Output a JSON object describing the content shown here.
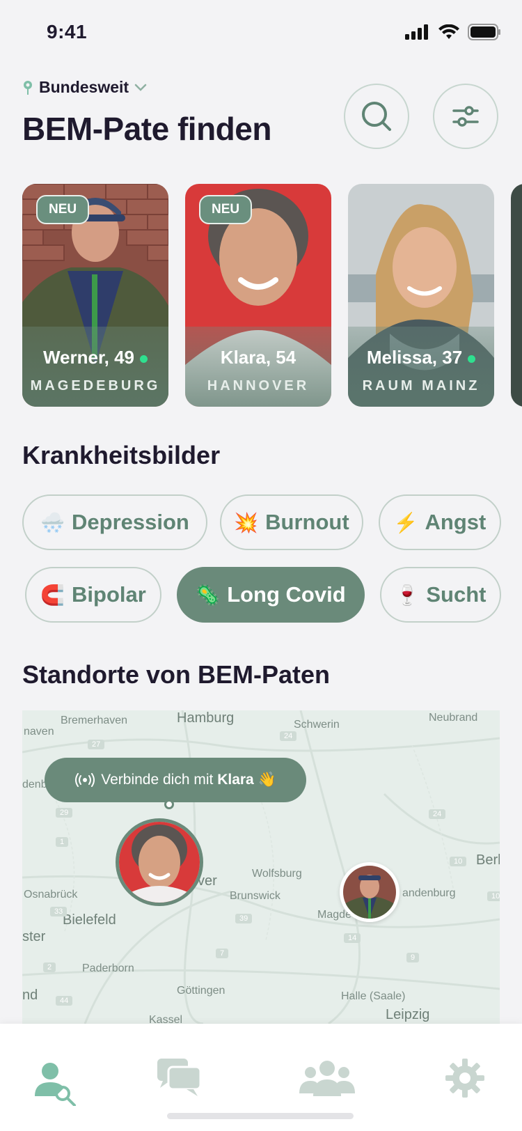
{
  "status_bar": {
    "time": "9:41"
  },
  "header": {
    "location": "Bundesweit",
    "title": "BEM-Pate finden"
  },
  "profiles": [
    {
      "name": "Werner, 49",
      "city": "MAGEDEBURG",
      "badge": "NEU",
      "online": true
    },
    {
      "name": "Klara, 54",
      "city": "HANNOVER",
      "badge": "NEU",
      "online": false
    },
    {
      "name": "Melissa, 37",
      "city": "RAUM MAINZ",
      "badge": "",
      "online": true
    }
  ],
  "conditions": {
    "title": "Krankheitsbilder",
    "chips": [
      {
        "label": "Depression",
        "emoji": "🌨️",
        "active": false
      },
      {
        "label": "Burnout",
        "emoji": "💥",
        "active": false
      },
      {
        "label": "Angst",
        "emoji": "⚡",
        "active": false
      },
      {
        "label": "Bipolar",
        "emoji": "🧲",
        "active": false
      },
      {
        "label": "Long Covid",
        "emoji": "🦠",
        "active": true
      },
      {
        "label": "Sucht",
        "emoji": "🍷",
        "active": false
      }
    ]
  },
  "map": {
    "title": "Standorte von BEM-Paten",
    "callout_prefix": "Verbinde dich mit ",
    "callout_name": "Klara",
    "callout_emoji": "👋",
    "labels": [
      "Bremerhaven",
      "Hamburg",
      "Schwerin",
      "Neubrand",
      "naven",
      "denb",
      "Osnabrück",
      "Bielefeld",
      "ster",
      "Paderborn",
      "nd",
      "Göttingen",
      "Kassel",
      "Wolfsburg",
      "Brunswick",
      "Magde",
      "andenburg",
      "Berl",
      "Halle (Saale)",
      "Leipzig",
      "ver"
    ],
    "road_numbers": [
      "27",
      "24",
      "29",
      "1",
      "33",
      "39",
      "7",
      "2",
      "44",
      "14",
      "9",
      "10",
      "24",
      "10"
    ]
  },
  "tabbar": {
    "tabs": [
      "search-person-icon",
      "chat-icon",
      "group-icon",
      "gear-icon"
    ]
  },
  "colors": {
    "accent": "#6a8a7a",
    "online": "#2fe08f",
    "background": "#f3f3f5"
  }
}
